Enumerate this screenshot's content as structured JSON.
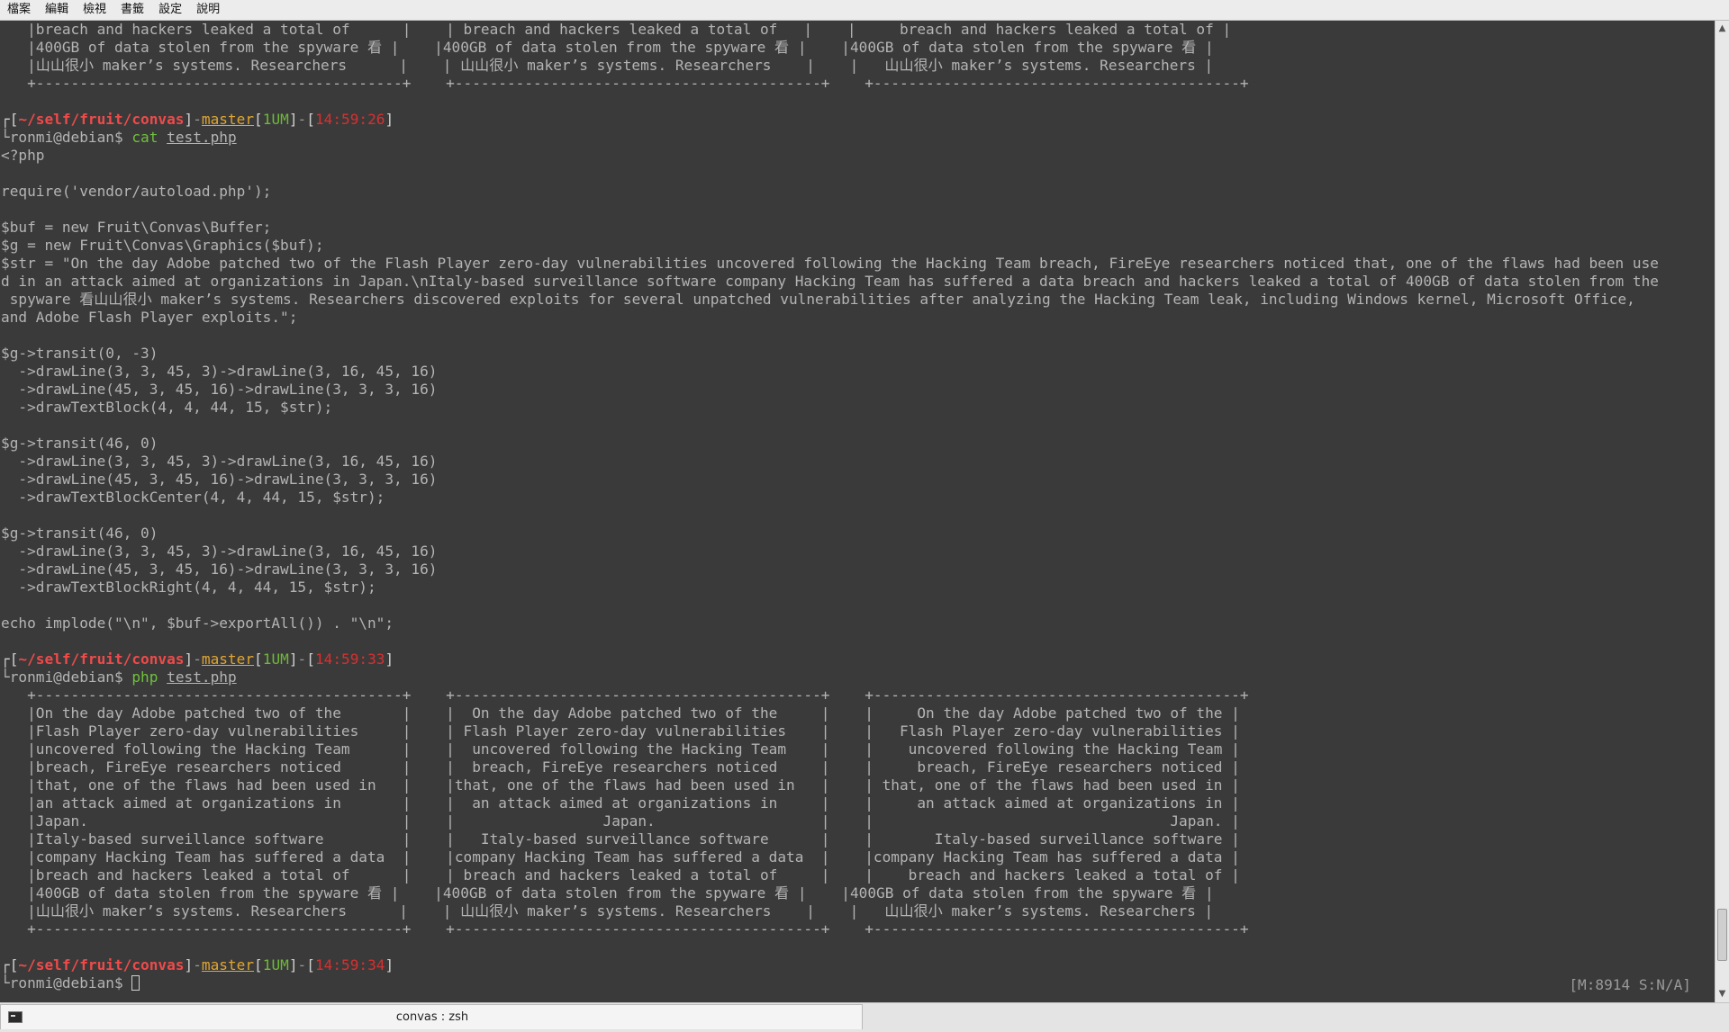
{
  "menubar": {
    "items": [
      "檔案",
      "編輯",
      "檢視",
      "書籤",
      "設定",
      "說明"
    ]
  },
  "terminal": {
    "lines": [
      [
        [
          "   |breach and hackers leaked a total of      |    | breach and hackers leaked a total of   |    |     breach and hackers leaked a total of |",
          "t"
        ]
      ],
      [
        [
          "   |400GB of data stolen from the spyware 看 |    |400GB of data stolen from the spyware 看 |    |400GB of data stolen from the spyware 看 |",
          "t"
        ]
      ],
      [
        [
          "   |山山很小 maker’s systems. Researchers      |    | 山山很小 maker’s systems. Researchers    |    |   山山很小 maker’s systems. Researchers |",
          "t"
        ]
      ],
      [
        [
          "   +------------------------------------------+    +------------------------------------------+    +------------------------------------------+",
          "t"
        ]
      ],
      [
        [
          "",
          "t"
        ]
      ],
      [
        [
          "┌[",
          "br"
        ],
        [
          "~/self/fruit/convas",
          "path"
        ],
        [
          "]",
          "br"
        ],
        [
          "-",
          "dash"
        ],
        [
          "master",
          "branch"
        ],
        [
          "[",
          "br"
        ],
        [
          "1UM",
          "count"
        ],
        [
          "]",
          "br"
        ],
        [
          "-",
          "dash"
        ],
        [
          "[",
          "br"
        ],
        [
          "14:59:26",
          "time"
        ],
        [
          "]",
          "br"
        ]
      ],
      [
        [
          "└ronmi@debian$ ",
          "user"
        ],
        [
          "cat",
          "cmd"
        ],
        [
          " ",
          "t"
        ],
        [
          "test.php",
          "arg"
        ]
      ],
      [
        [
          "<?php",
          "t"
        ]
      ],
      [
        [
          "",
          "t"
        ]
      ],
      [
        [
          "require('vendor/autoload.php');",
          "t"
        ]
      ],
      [
        [
          "",
          "t"
        ]
      ],
      [
        [
          "$buf = new Fruit\\Convas\\Buffer;",
          "t"
        ]
      ],
      [
        [
          "$g = new Fruit\\Convas\\Graphics($buf);",
          "t"
        ]
      ],
      [
        [
          "$str = \"On the day Adobe patched two of the Flash Player zero-day vulnerabilities uncovered following the Hacking Team breach, FireEye researchers noticed that, one of the flaws had been use",
          "t"
        ]
      ],
      [
        [
          "d in an attack aimed at organizations in Japan.\\nItaly-based surveillance software company Hacking Team has suffered a data breach and hackers leaked a total of 400GB of data stolen from the",
          "t"
        ]
      ],
      [
        [
          " spyware 看山山很小 maker’s systems. Researchers discovered exploits for several unpatched vulnerabilities after analyzing the Hacking Team leak, including Windows kernel, Microsoft Office,",
          "t"
        ]
      ],
      [
        [
          "and Adobe Flash Player exploits.\";",
          "t"
        ]
      ],
      [
        [
          "",
          "t"
        ]
      ],
      [
        [
          "$g->transit(0, -3)",
          "t"
        ]
      ],
      [
        [
          "  ->drawLine(3, 3, 45, 3)->drawLine(3, 16, 45, 16)",
          "t"
        ]
      ],
      [
        [
          "  ->drawLine(45, 3, 45, 16)->drawLine(3, 3, 3, 16)",
          "t"
        ]
      ],
      [
        [
          "  ->drawTextBlock(4, 4, 44, 15, $str);",
          "t"
        ]
      ],
      [
        [
          "",
          "t"
        ]
      ],
      [
        [
          "$g->transit(46, 0)",
          "t"
        ]
      ],
      [
        [
          "  ->drawLine(3, 3, 45, 3)->drawLine(3, 16, 45, 16)",
          "t"
        ]
      ],
      [
        [
          "  ->drawLine(45, 3, 45, 16)->drawLine(3, 3, 3, 16)",
          "t"
        ]
      ],
      [
        [
          "  ->drawTextBlockCenter(4, 4, 44, 15, $str);",
          "t"
        ]
      ],
      [
        [
          "",
          "t"
        ]
      ],
      [
        [
          "$g->transit(46, 0)",
          "t"
        ]
      ],
      [
        [
          "  ->drawLine(3, 3, 45, 3)->drawLine(3, 16, 45, 16)",
          "t"
        ]
      ],
      [
        [
          "  ->drawLine(45, 3, 45, 16)->drawLine(3, 3, 3, 16)",
          "t"
        ]
      ],
      [
        [
          "  ->drawTextBlockRight(4, 4, 44, 15, $str);",
          "t"
        ]
      ],
      [
        [
          "",
          "t"
        ]
      ],
      [
        [
          "echo implode(\"\\n\", $buf->exportAll()) . \"\\n\";",
          "t"
        ]
      ],
      [
        [
          "",
          "t"
        ]
      ],
      [
        [
          "┌[",
          "br"
        ],
        [
          "~/self/fruit/convas",
          "path"
        ],
        [
          "]",
          "br"
        ],
        [
          "-",
          "dash"
        ],
        [
          "master",
          "branch"
        ],
        [
          "[",
          "br"
        ],
        [
          "1UM",
          "count"
        ],
        [
          "]",
          "br"
        ],
        [
          "-",
          "dash"
        ],
        [
          "[",
          "br"
        ],
        [
          "14:59:33",
          "time"
        ],
        [
          "]",
          "br"
        ]
      ],
      [
        [
          "└ronmi@debian$ ",
          "user"
        ],
        [
          "php",
          "cmd"
        ],
        [
          " ",
          "t"
        ],
        [
          "test.php",
          "arg"
        ]
      ],
      [
        [
          "   +------------------------------------------+    +------------------------------------------+    +------------------------------------------+",
          "t"
        ]
      ],
      [
        [
          "   |On the day Adobe patched two of the       |    |  On the day Adobe patched two of the     |    |     On the day Adobe patched two of the |",
          "t"
        ]
      ],
      [
        [
          "   |Flash Player zero-day vulnerabilities     |    | Flash Player zero-day vulnerabilities    |    |   Flash Player zero-day vulnerabilities |",
          "t"
        ]
      ],
      [
        [
          "   |uncovered following the Hacking Team      |    |  uncovered following the Hacking Team    |    |    uncovered following the Hacking Team |",
          "t"
        ]
      ],
      [
        [
          "   |breach, FireEye researchers noticed       |    |  breach, FireEye researchers noticed     |    |     breach, FireEye researchers noticed |",
          "t"
        ]
      ],
      [
        [
          "   |that, one of the flaws had been used in   |    |that, one of the flaws had been used in   |    | that, one of the flaws had been used in |",
          "t"
        ]
      ],
      [
        [
          "   |an attack aimed at organizations in       |    |  an attack aimed at organizations in     |    |     an attack aimed at organizations in |",
          "t"
        ]
      ],
      [
        [
          "   |Japan.                                    |    |                 Japan.                   |    |                                  Japan. |",
          "t"
        ]
      ],
      [
        [
          "   |Italy-based surveillance software         |    |   Italy-based surveillance software      |    |       Italy-based surveillance software |",
          "t"
        ]
      ],
      [
        [
          "   |company Hacking Team has suffered a data  |    |company Hacking Team has suffered a data  |    |company Hacking Team has suffered a data |",
          "t"
        ]
      ],
      [
        [
          "   |breach and hackers leaked a total of      |    | breach and hackers leaked a total of     |    |    breach and hackers leaked a total of |",
          "t"
        ]
      ],
      [
        [
          "   |400GB of data stolen from the spyware 看 |    |400GB of data stolen from the spyware 看 |    |400GB of data stolen from the spyware 看 |",
          "t"
        ]
      ],
      [
        [
          "   |山山很小 maker’s systems. Researchers      |    | 山山很小 maker’s systems. Researchers    |    |   山山很小 maker’s systems. Researchers |",
          "t"
        ]
      ],
      [
        [
          "   +------------------------------------------+    +------------------------------------------+    +------------------------------------------+",
          "t"
        ]
      ],
      [
        [
          "",
          "t"
        ]
      ],
      [
        [
          "┌[",
          "br"
        ],
        [
          "~/self/fruit/convas",
          "path"
        ],
        [
          "]",
          "br"
        ],
        [
          "-",
          "dash"
        ],
        [
          "master",
          "branch"
        ],
        [
          "[",
          "br"
        ],
        [
          "1UM",
          "count"
        ],
        [
          "]",
          "br"
        ],
        [
          "-",
          "dash"
        ],
        [
          "[",
          "br"
        ],
        [
          "14:59:34",
          "time"
        ],
        [
          "]",
          "br"
        ]
      ],
      [
        [
          "└ronmi@debian$ ",
          "user"
        ]
      ]
    ],
    "right_prompt": "[M:8914 S:N/A]"
  },
  "tab": {
    "title": "convas : zsh"
  },
  "scrollbar": {
    "position": 0.97
  },
  "colors": {
    "background": "#3a3a3a",
    "text": "#b4b4b4",
    "path": "#ef4a4a",
    "branch": "#e0a632",
    "count": "#6fb83a",
    "time": "#d83030",
    "command": "#6fc13c"
  }
}
